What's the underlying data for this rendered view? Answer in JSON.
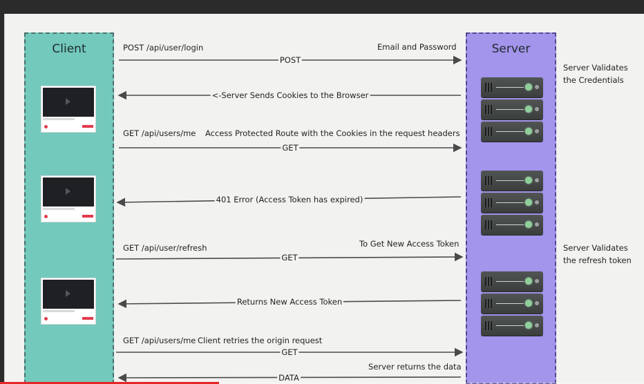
{
  "client": {
    "title": "Client"
  },
  "server": {
    "title": "Server"
  },
  "messages": [
    {
      "left_text": "POST /api/user/login",
      "right_text": "Email and Password",
      "arrow_label": "POST",
      "direction": "right"
    },
    {
      "arrow_label": "<-Server Sends Cookies to the Browser",
      "direction": "left"
    },
    {
      "left_text": "GET /api/users/me",
      "middle_text": "Access Protected Route with the Cookies in the request headers",
      "arrow_label": "GET",
      "direction": "right"
    },
    {
      "arrow_label": "401 Error (Access Token has expired)",
      "direction": "left"
    },
    {
      "left_text": "GET /api/user/refresh",
      "right_text": "To Get New Access Token",
      "arrow_label": "GET",
      "direction": "right"
    },
    {
      "arrow_label": "Returns New Access Token",
      "direction": "left"
    },
    {
      "left_text": "GET /api/users/me",
      "middle_text": "Client retries the origin request",
      "arrow_label": "GET",
      "direction": "right"
    },
    {
      "right_text": "Server returns the data",
      "arrow_label": "DATA",
      "direction": "left"
    }
  ],
  "notes": {
    "validate_credentials": [
      "Server Validates",
      "the Credentials"
    ],
    "validate_refresh": [
      "Server Validates",
      "the refresh token"
    ]
  },
  "colors": {
    "client_bg": "#73c9bc",
    "server_bg": "#a394ec",
    "arrow": "#4a4a4a",
    "progress": "#e52626"
  },
  "video": {
    "progress_fraction": 0.34
  },
  "icons": {
    "client_thumbnail": "video-thumbnail-icon",
    "server": "server-rack-icon"
  }
}
